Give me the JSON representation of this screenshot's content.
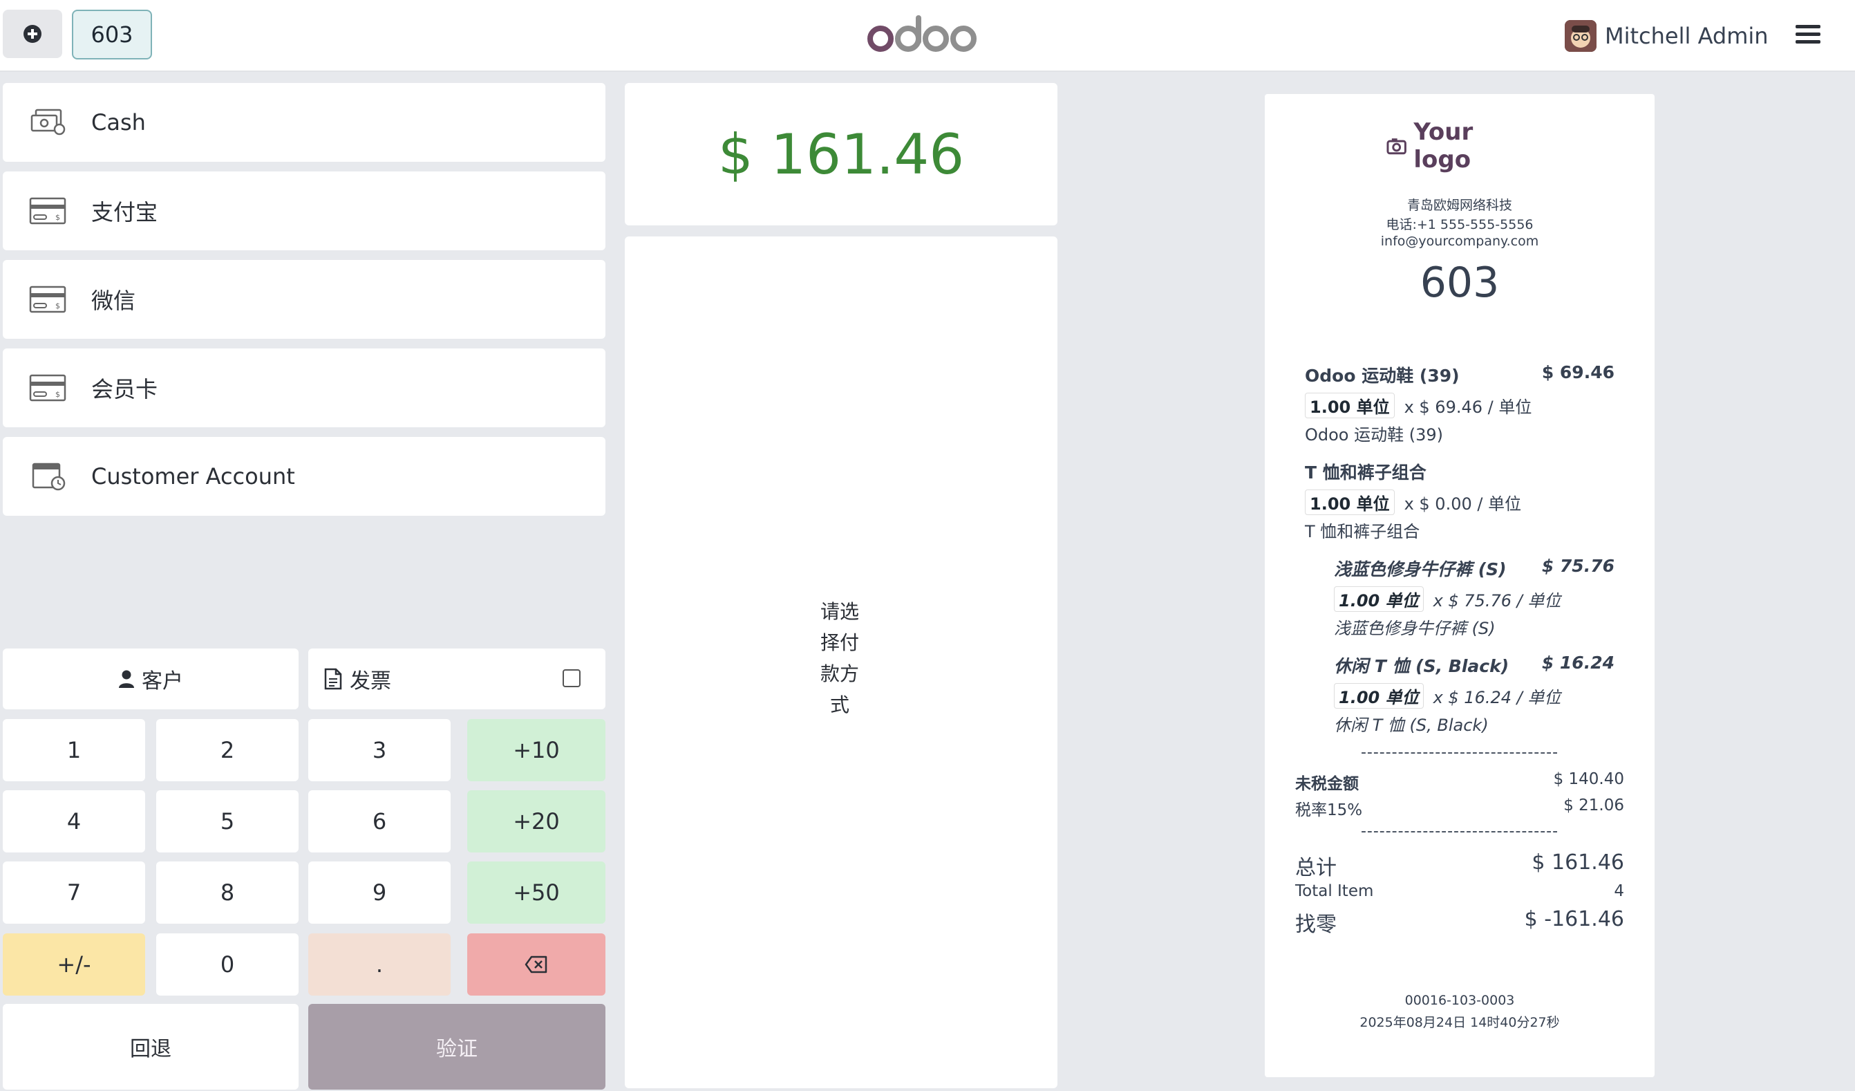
{
  "topbar": {
    "order_tab": "603",
    "user_name": "Mitchell Admin"
  },
  "payment_methods": [
    {
      "label": "Cash",
      "icon": "cash-icon"
    },
    {
      "label": "支付宝",
      "icon": "card-icon"
    },
    {
      "label": "微信",
      "icon": "card-icon"
    },
    {
      "label": "会员卡",
      "icon": "card-icon"
    },
    {
      "label": "Customer Account",
      "icon": "customer-account-icon"
    }
  ],
  "controls": {
    "customer_label": "客户",
    "invoice_label": "发票"
  },
  "numpad": {
    "k1": "1",
    "k2": "2",
    "k3": "3",
    "k_plus10": "+10",
    "k4": "4",
    "k5": "5",
    "k6": "6",
    "k_plus20": "+20",
    "k7": "7",
    "k8": "8",
    "k9": "9",
    "k_plus50": "+50",
    "k_sign": "+/-",
    "k0": "0",
    "k_dot": "."
  },
  "actions": {
    "back_label": "回退",
    "validate_label": "验证"
  },
  "center": {
    "total_due": "$ 161.46",
    "select_message": "请选择付款方式"
  },
  "receipt": {
    "logo_text": "Your logo",
    "company_name": "青岛欧姆网络科技",
    "phone": "电话:+1 555-555-5556",
    "email": "info@yourcompany.com",
    "order_number": "603",
    "lines": [
      {
        "name": "Odoo 运动鞋 (39)",
        "price": "$ 69.46",
        "qty": "1.00 单位",
        "unit_price": "x $ 69.46 / 单位",
        "note": "Odoo 运动鞋 (39)"
      },
      {
        "name": "T 恤和裤子组合",
        "price": "",
        "qty": "1.00 单位",
        "unit_price": "x $ 0.00 / 单位",
        "note": "T 恤和裤子组合"
      },
      {
        "name": "浅蓝色修身牛仔裤 (S)",
        "price": "$ 75.76",
        "qty": "1.00 单位",
        "unit_price": "x $ 75.76 / 单位",
        "note": "浅蓝色修身牛仔裤 (S)"
      },
      {
        "name": "休闲 T 恤 (S, Black)",
        "price": "$ 16.24",
        "qty": "1.00 单位",
        "unit_price": "x $ 16.24 / 单位",
        "note": "休闲 T 恤 (S, Black)"
      }
    ],
    "separator": "--------------------------------",
    "untaxed_label": "未税金额",
    "untaxed_value": "$ 140.40",
    "tax_label": "税率15%",
    "tax_value": "$ 21.06",
    "total_label": "总计",
    "total_value": "$ 161.46",
    "total_items_label": "Total Item",
    "total_items_value": "4",
    "change_label": "找零",
    "change_value": "$ -161.46",
    "ref": "00016-103-0003",
    "datetime": "2025年08月24日 14时40分27秒"
  },
  "colors": {
    "accent_green": "#3d8a37",
    "validate_bg": "#a89ea8",
    "brand": "#714b67"
  }
}
